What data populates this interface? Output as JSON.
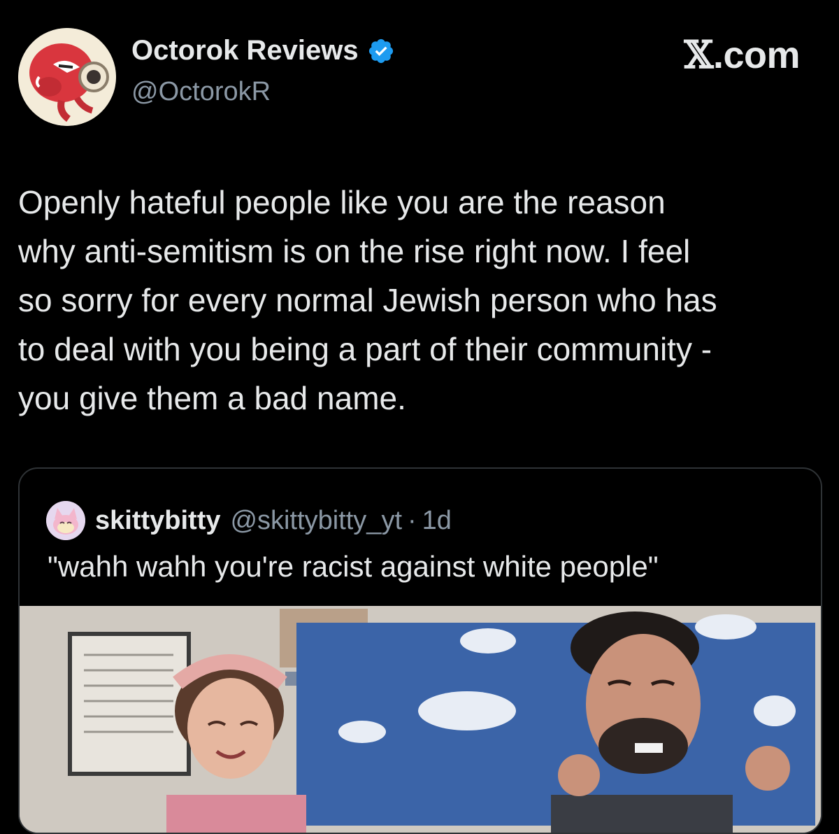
{
  "author": {
    "display_name": "Octorok Reviews",
    "handle": "@OctorokR",
    "verified_icon": "verified-badge-icon",
    "avatar_icon": "octorok-avatar"
  },
  "brand": {
    "x_glyph": "𝕏",
    "suffix": ".com"
  },
  "post": {
    "lines": [
      "Openly hateful people like you are the reason",
      "why anti-semitism is on the rise right now. I feel",
      "so sorry for every normal Jewish person who has",
      "to deal with you being a part of their community -",
      "you give them a bad name."
    ]
  },
  "quoted_post": {
    "display_name": "skittybitty",
    "handle": "@skittybitty_yt",
    "separator": "·",
    "time": "1d",
    "text": "\"wahh wahh you're racist against white people\"",
    "avatar_icon": "skitty-avatar",
    "media": "classroom-photo"
  },
  "colors": {
    "background": "#000000",
    "text": "#e7e9ea",
    "muted": "#8b98a5",
    "border": "#2f3336",
    "verified": "#1d9bf0"
  }
}
